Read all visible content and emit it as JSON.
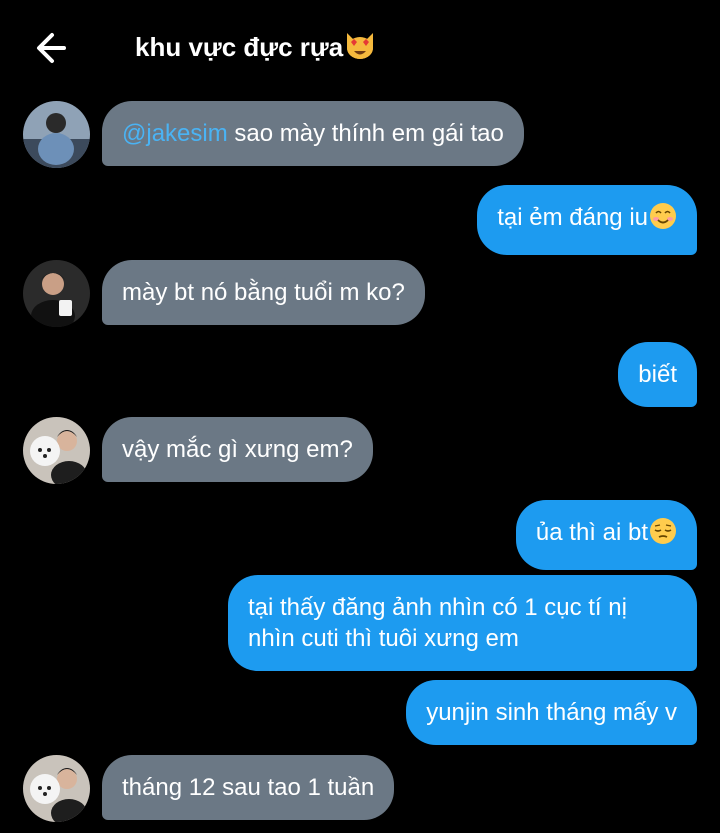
{
  "header": {
    "title": "khu vực đực rựa",
    "title_emoji": "smiling-cat-heart-eyes-emoji"
  },
  "messages": [
    {
      "side": "in",
      "mention": "@jakesim",
      "text": " sao mày thính em gái tao",
      "avatar": "avatar-man-blue-hoodie"
    },
    {
      "side": "out",
      "text": "tại ẻm đáng iu",
      "emoji": "smiling-face-emoji"
    },
    {
      "side": "in",
      "text": "mày bt nó bằng tuổi m ko?",
      "avatar": "avatar-man-holding-cup"
    },
    {
      "side": "out",
      "text": "biết"
    },
    {
      "side": "in",
      "text": "vậy mắc gì xưng em?",
      "avatar": "avatar-man-with-white-dog"
    },
    {
      "side": "out",
      "text": "ủa thì ai bt",
      "emoji": "pensive-face-emoji"
    },
    {
      "side": "out",
      "text": "tại thấy đăng ảnh nhìn có 1 cục tí nị nhìn cuti thì tuôi xưng em"
    },
    {
      "side": "out",
      "text": "yunjin sinh tháng mấy v"
    },
    {
      "side": "in",
      "text": "tháng 12 sau tao 1 tuần",
      "avatar": "avatar-man-with-white-dog"
    }
  ],
  "colors": {
    "background": "#000000",
    "incoming_bubble": "#6b7885",
    "outgoing_bubble": "#1d9bf0",
    "mention": "#4ab3f4"
  }
}
